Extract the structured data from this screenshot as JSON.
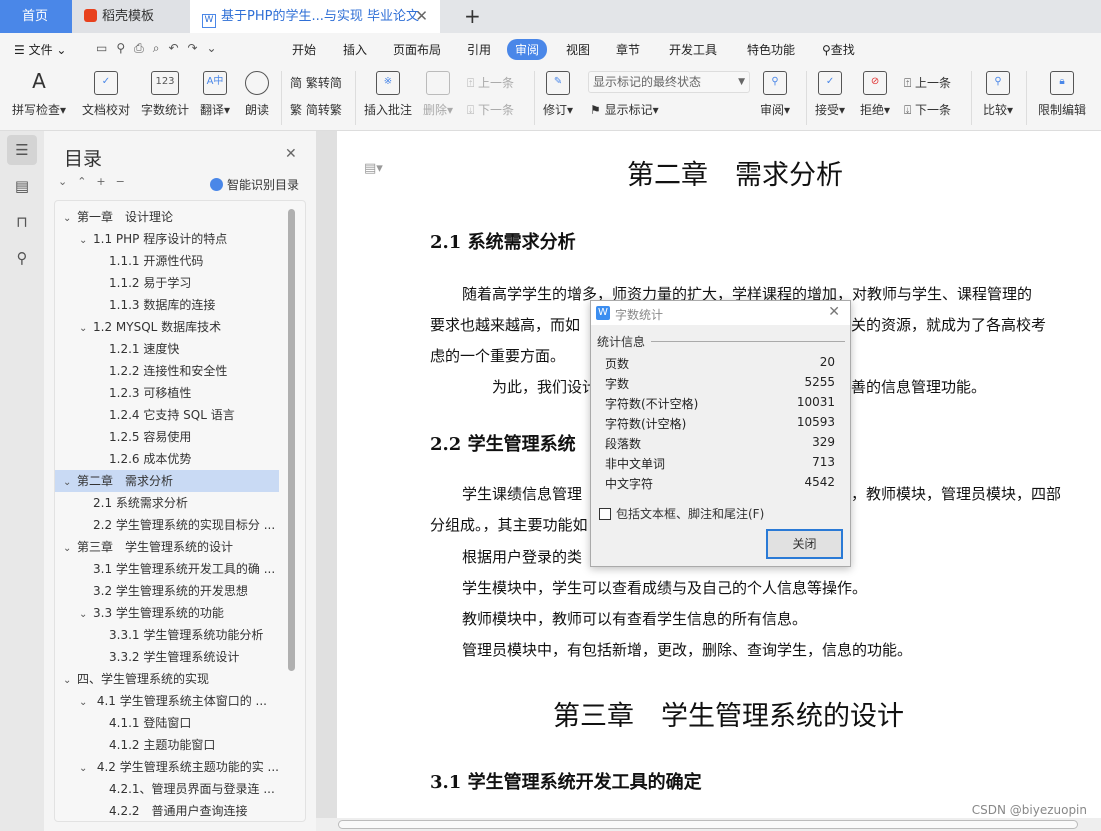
{
  "tabs": [
    {
      "label": "首页"
    },
    {
      "label": "稻壳模板"
    },
    {
      "label": "基于PHP的学生...与实现 毕业论文"
    }
  ],
  "menu": {
    "file": "文件",
    "items": [
      "开始",
      "插入",
      "页面布局",
      "引用",
      "审阅",
      "视图",
      "章节",
      "开发工具",
      "特色功能"
    ],
    "active": "审阅",
    "search": "查找"
  },
  "ribbon": {
    "spell": "拼写检查",
    "proof": "文档校对",
    "wordcount": "字数统计",
    "translate": "翻译",
    "read": "朗读",
    "t2s": "繁转简",
    "s2t": "简转繁",
    "insert_comment": "插入批注",
    "delete": "删除",
    "prev": "上一条",
    "next": "下一条",
    "revise": "修订",
    "markup_state": "显示标记的最终状态",
    "show_markup": "显示标记",
    "review": "审阅",
    "accept": "接受",
    "reject": "拒绝",
    "prev2": "上一条",
    "next2": "下一条",
    "compare": "比较",
    "restrict": "限制编辑"
  },
  "sidebar": {
    "title": "目录",
    "smart": "智能识别目录",
    "items": [
      {
        "label": "第一章　设计理论",
        "level": 0,
        "expand": true
      },
      {
        "label": "1.1 PHP  程序设计的特点",
        "level": 1,
        "expand": true
      },
      {
        "label": "1.1.1 开源性代码",
        "level": 2
      },
      {
        "label": "1.1.2 易于学习",
        "level": 2
      },
      {
        "label": "1.1.3 数据库的连接",
        "level": 2
      },
      {
        "label": "1.2 MYSQL  数据库技术",
        "level": 1,
        "expand": true
      },
      {
        "label": "1.2.1 速度快",
        "level": 2
      },
      {
        "label": "1.2.2 连接性和安全性",
        "level": 2
      },
      {
        "label": "1.2.3 可移植性",
        "level": 2
      },
      {
        "label": "1.2.4 它支持 SQL 语言",
        "level": 2
      },
      {
        "label": "1.2.5 容易使用",
        "level": 2
      },
      {
        "label": "1.2.6 成本优势",
        "level": 2
      },
      {
        "label": "第二章　需求分析",
        "level": 0,
        "expand": true,
        "selected": true
      },
      {
        "label": "2.1 系统需求分析",
        "level": 1
      },
      {
        "label": "2.2  学生管理系统的实现目标分 ...",
        "level": 1
      },
      {
        "label": "第三章　学生管理系统的设计",
        "level": 0,
        "expand": true
      },
      {
        "label": "3.1  学生管理系统开发工具的确 ...",
        "level": 1
      },
      {
        "label": "3.2  学生管理系统的开发思想",
        "level": 1
      },
      {
        "label": "3.3  学生管理系统的功能",
        "level": 1,
        "expand": true
      },
      {
        "label": "3.3.1  学生管理系统功能分析",
        "level": 2
      },
      {
        "label": "3.3.2 学生管理系统设计",
        "level": 2
      },
      {
        "label": "四、学生管理系统的实现",
        "level": 0,
        "expand": true
      },
      {
        "label": "  4.1  学生管理系统主体窗口的 ...",
        "level": 1,
        "expand": true
      },
      {
        "label": "4.1.1 登陆窗口",
        "level": 2
      },
      {
        "label": "4.1.2 主题功能窗口",
        "level": 2
      },
      {
        "label": "  4.2 学生管理系统主题功能的实 ...",
        "level": 1,
        "expand": true
      },
      {
        "label": "4.2.1、管理员界面与登录连 ...",
        "level": 2
      },
      {
        "label": "4.2.2　普通用户查询连接",
        "level": 2
      }
    ]
  },
  "doc": {
    "ch2": "第二章　需求分析",
    "h21": "2.1 系统需求分析",
    "l1": "随着高学学生的增多，师资力量的扩大，学样课程的增加，对教师与学生、课程管理的",
    "l2a": "要求也越来越高，而如",
    "l2b": "关的资源，就成为了各高校考",
    "l3": "虑的一个重要方面。",
    "l4a": "为此，我们设计",
    "l4b": "善的信息管理功能。",
    "h22": "2.2  学生管理系统",
    "l5a": "学生课绩信息管理",
    "l5b": "，教师模块，管理员模块，四部",
    "l6": "分组成。，其主要功能如",
    "l7": "根据用户登录的类",
    "l8": "学生模块中，学生可以查看成绩与及自己的个人信息等操作。",
    "l9": "教师模块中，教师可以有查看学生信息的所有信息。",
    "l10": "管理员模块中，有包括新增，更改，删除、查询学生，信息的功能。",
    "ch3": "第三章　学生管理系统的设计",
    "h31": "3.1  学生管理系统开发工具的确定"
  },
  "dialog": {
    "title": "字数统计",
    "group": "统计信息",
    "rows": [
      {
        "label": "页数",
        "value": "20"
      },
      {
        "label": "字数",
        "value": "5255"
      },
      {
        "label": "字符数(不计空格)",
        "value": "10031"
      },
      {
        "label": "字符数(计空格)",
        "value": "10593"
      },
      {
        "label": "段落数",
        "value": "329"
      },
      {
        "label": "非中文单词",
        "value": "713"
      },
      {
        "label": "中文字符",
        "value": "4542"
      }
    ],
    "checkbox": "包括文本框、脚注和尾注(F)",
    "checked": false,
    "close": "关闭"
  },
  "watermark": "CSDN @biyezuopin",
  "colors": {
    "accent": "#4a87e8",
    "selected": "#c9daf4"
  }
}
